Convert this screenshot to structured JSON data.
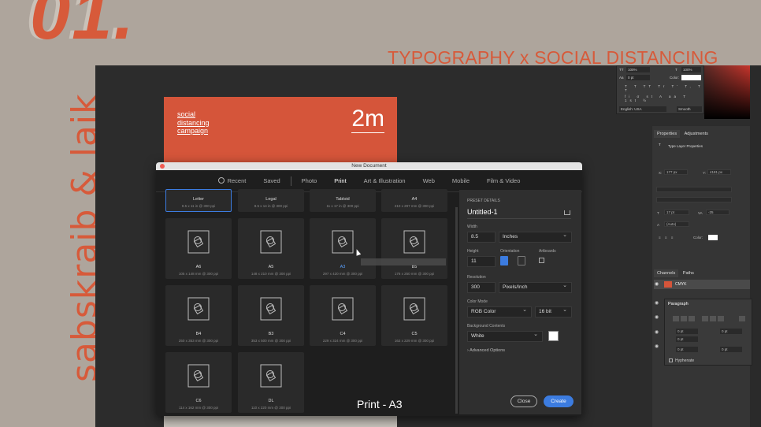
{
  "slide": {
    "number": "01.",
    "headline": "TYPOGRAPHY x SOCIAL DISTANCING",
    "authors": "sabskraib & laik",
    "caption": "Print - A3"
  },
  "canvas": {
    "campaign_lines": [
      "social",
      "distancing",
      "campaign"
    ],
    "distance": "2m"
  },
  "dialog": {
    "title": "New Document",
    "tabs": [
      {
        "label": "Recent",
        "active": false
      },
      {
        "label": "Saved",
        "active": false
      },
      {
        "label": "Photo",
        "active": false
      },
      {
        "label": "Print",
        "active": true
      },
      {
        "label": "Art & Illustration",
        "active": false
      },
      {
        "label": "Web",
        "active": false
      },
      {
        "label": "Mobile",
        "active": false
      },
      {
        "label": "Film & Video",
        "active": false
      }
    ],
    "presets": [
      {
        "name": "Letter",
        "size": "8.5 x 11 in @ 300 ppi",
        "selected": true
      },
      {
        "name": "Legal",
        "size": "8.5 x 14 in @ 300 ppi"
      },
      {
        "name": "Tabloid",
        "size": "11 x 17 in @ 300 ppi"
      },
      {
        "name": "A4",
        "size": "210 x 297 mm @ 300 ppi"
      },
      {
        "name": "A6",
        "size": "105 x 148 mm @ 300 ppi"
      },
      {
        "name": "A5",
        "size": "148 x 210 mm @ 300 ppi"
      },
      {
        "name": "A3",
        "size": "297 x 420 mm @ 300 ppi",
        "hover": true
      },
      {
        "name": "B5",
        "size": "176 x 250 mm @ 300 ppi"
      },
      {
        "name": "B4",
        "size": "250 x 353 mm @ 300 ppi"
      },
      {
        "name": "B3",
        "size": "353 x 500 mm @ 300 ppi"
      },
      {
        "name": "C4",
        "size": "229 x 324 mm @ 300 ppi"
      },
      {
        "name": "C5",
        "size": "162 x 229 mm @ 300 ppi"
      },
      {
        "name": "C6",
        "size": "114 x 162 mm @ 300 ppi"
      },
      {
        "name": "DL",
        "size": "110 x 220 mm @ 300 ppi"
      }
    ],
    "preset_details": {
      "header": "PRESET DETAILS",
      "doc_name": "Untitled-1",
      "width_label": "Width",
      "width": "8.5",
      "width_unit": "Inches",
      "height_label": "Height",
      "height": "11",
      "orientation_label": "Orientation",
      "artboards_label": "Artboards",
      "resolution_label": "Resolution",
      "resolution": "300",
      "resolution_unit": "Pixels/Inch",
      "color_mode_label": "Color Mode",
      "color_mode": "RGB Color",
      "bit_depth": "16 bit",
      "background_label": "Background Contents",
      "background": "White",
      "advanced": "Advanced Options",
      "close": "Close",
      "create": "Create"
    }
  },
  "character_panel": {
    "size": "100%",
    "tracking": "100%",
    "baseline": "0 pt",
    "color_label": "Color:",
    "language": "English: USA",
    "aa": "Smooth"
  },
  "properties_panel": {
    "tabs": [
      "Properties",
      "Adjustments"
    ],
    "subtitle": "Type Layer Properties",
    "x": "177 px",
    "y": "4181 px",
    "font_size": "17 pt",
    "tracking": "-25",
    "leading": "(Auto)",
    "color_label": "Color:"
  },
  "channels_panel": {
    "tabs": [
      "Channels",
      "Paths"
    ],
    "channel": "CMYK"
  },
  "paragraph_panel": {
    "title": "Paragraph",
    "fields": [
      "0 pt",
      "0 pt",
      "0 pt",
      "0 pt",
      "0 pt"
    ],
    "hyphenate": "Hyphenate"
  },
  "colors": {
    "accent": "#d75a3a",
    "background": "#aea59c",
    "create_button": "#3c7ce0"
  }
}
